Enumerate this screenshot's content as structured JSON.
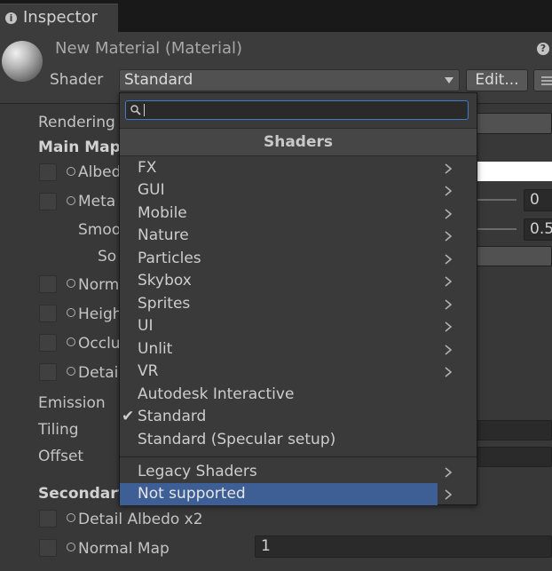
{
  "window": {
    "tab_label": "Inspector",
    "tab_icon": "info-icon"
  },
  "header": {
    "title": "New Material (Material)",
    "shader_label": "Shader",
    "shader_value": "Standard",
    "edit_label": "Edit...",
    "help_icon": "help-icon"
  },
  "background": {
    "rendering": "Rendering",
    "main_maps": "Main Map",
    "albedo": "Albed",
    "metallic": "Meta",
    "metallic_value": "0",
    "smoothness": "Smoo",
    "smoothness_value": "0.5",
    "source": "So",
    "normal": "Norm",
    "height": "Heigh",
    "occlusion": "Occlu",
    "detail_mask": "Detai",
    "emission": "Emission",
    "tiling": "Tiling",
    "offset": "Offset",
    "secondary": "Secondary",
    "detail_albedo": "Detail Albedo x2",
    "normal_map": "Normal Map",
    "normal_map_value": "1"
  },
  "menu": {
    "search_value": "",
    "heading": "Shaders",
    "items": [
      {
        "label": "FX",
        "submenu": true
      },
      {
        "label": "GUI",
        "submenu": true
      },
      {
        "label": "Mobile",
        "submenu": true
      },
      {
        "label": "Nature",
        "submenu": true
      },
      {
        "label": "Particles",
        "submenu": true
      },
      {
        "label": "Skybox",
        "submenu": true
      },
      {
        "label": "Sprites",
        "submenu": true
      },
      {
        "label": "UI",
        "submenu": true
      },
      {
        "label": "Unlit",
        "submenu": true
      },
      {
        "label": "VR",
        "submenu": true
      },
      {
        "label": "Autodesk Interactive",
        "submenu": false
      },
      {
        "label": "Standard",
        "submenu": false,
        "checked": true,
        "check_glyph": "✔"
      },
      {
        "label": "Standard (Specular setup)",
        "submenu": false
      }
    ],
    "bottom_items": [
      {
        "label": "Legacy Shaders",
        "submenu": true
      },
      {
        "label": "Not supported",
        "submenu": true,
        "highlighted": true
      }
    ]
  },
  "colors": {
    "accent": "#3e5f96",
    "search_focus": "#3f7bc8",
    "panel": "#383838"
  }
}
